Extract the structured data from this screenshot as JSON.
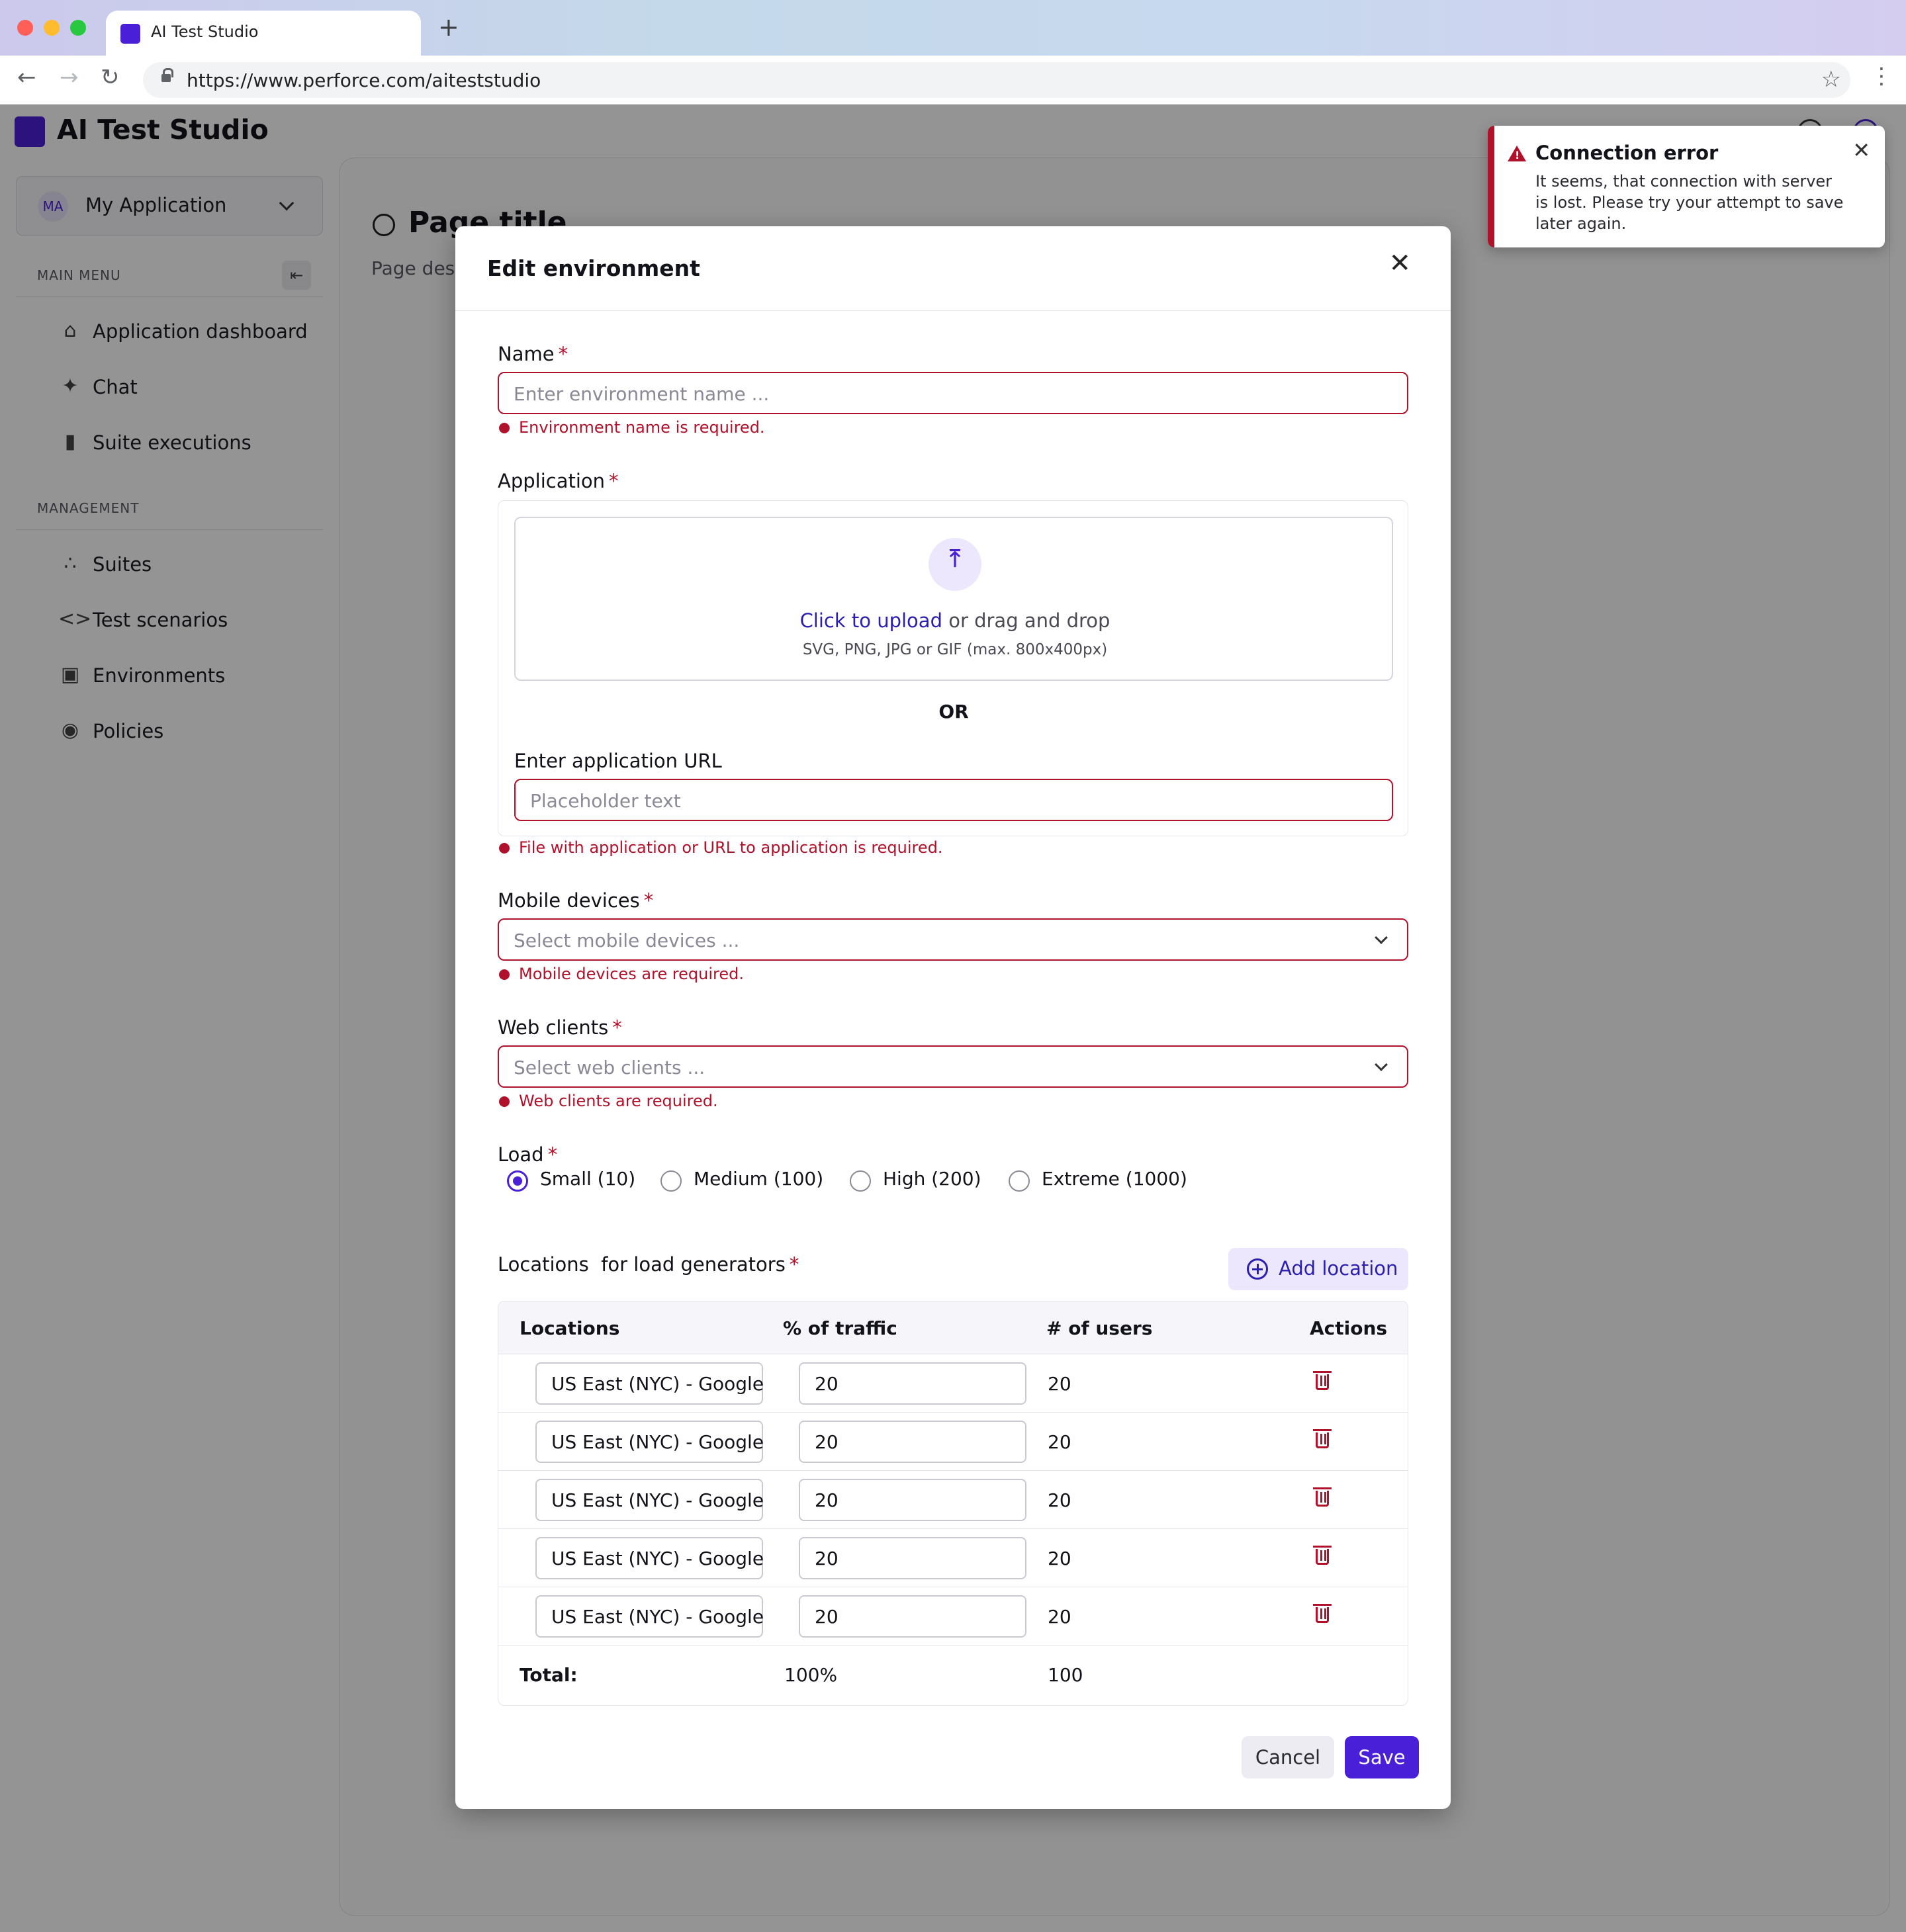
{
  "browser": {
    "tab_title": "AI Test Studio",
    "new_tab_symbol": "+",
    "url": "https://www.perforce.com/aiteststudio"
  },
  "app": {
    "title": "AI Test Studio",
    "brand_color": "#4a1fd8",
    "error_color": "#b0122b"
  },
  "sidebar": {
    "app_selector": {
      "avatar": "MA",
      "name": "My Application"
    },
    "main_menu_label": "MAIN MENU",
    "main_items": [
      {
        "label": "Application dashboard",
        "icon": "home-icon"
      },
      {
        "label": "Chat",
        "icon": "sparkle-icon"
      },
      {
        "label": "Suite executions",
        "icon": "bar-chart-icon"
      }
    ],
    "management_label": "MANAGEMENT",
    "management_items": [
      {
        "label": "Suites",
        "icon": "nodes-icon"
      },
      {
        "label": "Test scenarios",
        "icon": "code-icon"
      },
      {
        "label": "Environments",
        "icon": "devices-icon"
      },
      {
        "label": "Policies",
        "icon": "shield-icon"
      }
    ]
  },
  "page": {
    "title": "Page title",
    "description": "Page desc"
  },
  "toast": {
    "title": "Connection error",
    "message": "It seems, that connection with server is lost. Please try your attempt to save later again."
  },
  "modal": {
    "title": "Edit environment",
    "required_mark": "*",
    "name": {
      "label": "Name",
      "placeholder": "Enter environment name ...",
      "error": "Environment name is required."
    },
    "application": {
      "label": "Application",
      "upload_link": "Click to upload",
      "upload_rest": " or drag and drop",
      "upload_hint": "SVG, PNG, JPG or GIF (max. 800x400px)",
      "or": "OR",
      "url_label": "Enter application URL",
      "url_placeholder": "Placeholder text",
      "error": "File with application or URL to application is required."
    },
    "mobile": {
      "label": "Mobile devices",
      "placeholder": "Select mobile devices ...",
      "error": "Mobile devices are required."
    },
    "web": {
      "label": "Web clients",
      "placeholder": "Select web clients ...",
      "error": "Web clients are required."
    },
    "load": {
      "label": "Load",
      "options": [
        "Small (10)",
        "Medium (100)",
        "High (200)",
        "Extreme (1000)"
      ],
      "selected": "Small (10)"
    },
    "locations": {
      "label": "Locations  for load generators",
      "add_button": "Add location",
      "columns": [
        "Locations",
        "% of traffic",
        "# of users",
        "Actions"
      ],
      "rows": [
        {
          "location": "US East (NYC) - Google",
          "traffic": "20",
          "users": "20"
        },
        {
          "location": "US East (NYC) - Google",
          "traffic": "20",
          "users": "20"
        },
        {
          "location": "US East (NYC) - Google",
          "traffic": "20",
          "users": "20"
        },
        {
          "location": "US East (NYC) - Google",
          "traffic": "20",
          "users": "20"
        },
        {
          "location": "US East (NYC) - Google",
          "traffic": "20",
          "users": "20"
        }
      ],
      "total_label": "Total:",
      "total_traffic": "100%",
      "total_users": "100"
    },
    "cancel": "Cancel",
    "save": "Save"
  }
}
